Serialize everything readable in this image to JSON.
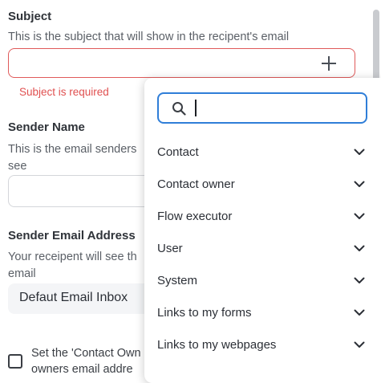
{
  "subject": {
    "label": "Subject",
    "help": "This is the subject that will show in the recipent's email",
    "value": "",
    "error": "Subject is required"
  },
  "sender_name": {
    "label": "Sender Name",
    "help_line1": "This is the email senders",
    "help_line2": "see"
  },
  "sender_email": {
    "label": "Sender Email Address",
    "help_line1": "Your receipent will see th",
    "help_line2": "email",
    "value": "Defaut Email Inbox"
  },
  "contact_owner_option": {
    "line1": "Set the 'Contact Own",
    "line2": "owners email addre"
  },
  "variable_picker": {
    "search_value": "",
    "items": [
      {
        "label": "Contact",
        "icon": "chevron-down-icon"
      },
      {
        "label": "Contact owner",
        "icon": "chevron-down-icon"
      },
      {
        "label": "Flow executor",
        "icon": "chevron-down-icon"
      },
      {
        "label": "User",
        "icon": "chevron-down-icon"
      },
      {
        "label": "System",
        "icon": "chevron-down-icon"
      },
      {
        "label": "Links to my forms",
        "icon": "chevron-down-icon"
      },
      {
        "label": "Links to my webpages",
        "icon": "chevron-down-icon"
      }
    ]
  },
  "colors": {
    "error": "#e05050",
    "focus": "#2f7ed8"
  }
}
